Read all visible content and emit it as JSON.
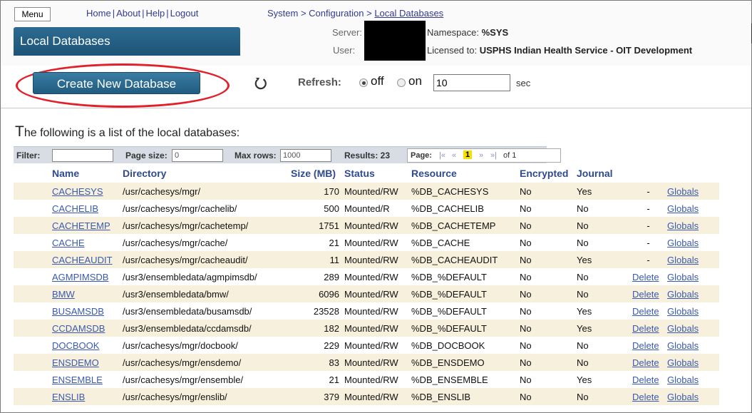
{
  "header": {
    "menu_label": "Menu",
    "links": [
      "Home",
      "About",
      "Help",
      "Logout"
    ],
    "breadcrumb": [
      "System",
      "Configuration",
      "Local Databases"
    ],
    "title": "Local Databases",
    "server_label": "Server:",
    "user_label": "User:",
    "namespace_label": "Namespace:",
    "namespace_value": "%SYS",
    "licensed_label": "Licensed to:",
    "licensed_value": "USPHS Indian Health Service - OIT Development"
  },
  "toolbar": {
    "create_label": "Create New Database",
    "refresh_label": "Refresh:",
    "off_label": "off",
    "on_label": "on",
    "refresh_value": "10",
    "sec_label": "sec"
  },
  "intro": {
    "first": "T",
    "rest": "he following is a list of the local databases:"
  },
  "filter": {
    "filter_label": "Filter:",
    "filter_value": "",
    "page_size_label": "Page size:",
    "page_size_value": "0",
    "max_rows_label": "Max rows:",
    "max_rows_value": "1000",
    "results_label": "Results: 23",
    "page_label": "Page:",
    "first": "|«",
    "prev": "«",
    "current": "1",
    "next": "»",
    "last": "»|",
    "of": "of 1"
  },
  "table": {
    "columns": [
      "Name",
      "Directory",
      "Size (MB)",
      "Status",
      "Resource",
      "Encrypted",
      "Journal",
      "",
      ""
    ],
    "rows": [
      [
        "CACHESYS",
        "/usr/cachesys/mgr/",
        "170",
        "Mounted/RW",
        "%DB_CACHESYS",
        "No",
        "Yes",
        "-",
        "Globals"
      ],
      [
        "CACHELIB",
        "/usr/cachesys/mgr/cachelib/",
        "500",
        "Mounted/R",
        "%DB_CACHELIB",
        "No",
        "No",
        "-",
        "Globals"
      ],
      [
        "CACHETEMP",
        "/usr/cachesys/mgr/cachetemp/",
        "1751",
        "Mounted/RW",
        "%DB_CACHETEMP",
        "No",
        "No",
        "-",
        "Globals"
      ],
      [
        "CACHE",
        "/usr/cachesys/mgr/cache/",
        "21",
        "Mounted/RW",
        "%DB_CACHE",
        "No",
        "No",
        "-",
        "Globals"
      ],
      [
        "CACHEAUDIT",
        "/usr/cachesys/mgr/cacheaudit/",
        "11",
        "Mounted/RW",
        "%DB_CACHEAUDIT",
        "No",
        "Yes",
        "-",
        "Globals"
      ],
      [
        "AGMPIMSDB",
        "/usr3/ensembledata/agmpimsdb/",
        "289",
        "Mounted/RW",
        "%DB_%DEFAULT",
        "No",
        "No",
        "Delete",
        "Globals"
      ],
      [
        "BMW",
        "/usr3/ensembledata/bmw/",
        "6096",
        "Mounted/RW",
        "%DB_%DEFAULT",
        "No",
        "No",
        "Delete",
        "Globals"
      ],
      [
        "BUSAMSDB",
        "/usr3/ensembledata/busamsdb/",
        "23528",
        "Mounted/RW",
        "%DB_%DEFAULT",
        "No",
        "Yes",
        "Delete",
        "Globals"
      ],
      [
        "CCDAMSDB",
        "/usr3/ensembledata/ccdamsdb/",
        "182",
        "Mounted/RW",
        "%DB_%DEFAULT",
        "No",
        "Yes",
        "Delete",
        "Globals"
      ],
      [
        "DOCBOOK",
        "/usr/cachesys/mgr/docbook/",
        "229",
        "Mounted/RW",
        "%DB_DOCBOOK",
        "No",
        "No",
        "Delete",
        "Globals"
      ],
      [
        "ENSDEMO",
        "/usr/cachesys/mgr/ensdemo/",
        "83",
        "Mounted/RW",
        "%DB_ENSDEMO",
        "No",
        "No",
        "Delete",
        "Globals"
      ],
      [
        "ENSEMBLE",
        "/usr/cachesys/mgr/ensemble/",
        "21",
        "Mounted/RW",
        "%DB_ENSEMBLE",
        "No",
        "Yes",
        "Delete",
        "Globals"
      ],
      [
        "ENSLIB",
        "/usr/cachesys/mgr/enslib/",
        "379",
        "Mounted/RW",
        "%DB_ENSLIB",
        "No",
        "No",
        "Delete",
        "Globals"
      ]
    ]
  },
  "colors": {
    "accent": "#215c80",
    "link": "#3a5ab0",
    "row_alt": "#f6f0dc",
    "highlight": "#e2202a"
  },
  "icons": {
    "refresh": "refresh-icon"
  }
}
